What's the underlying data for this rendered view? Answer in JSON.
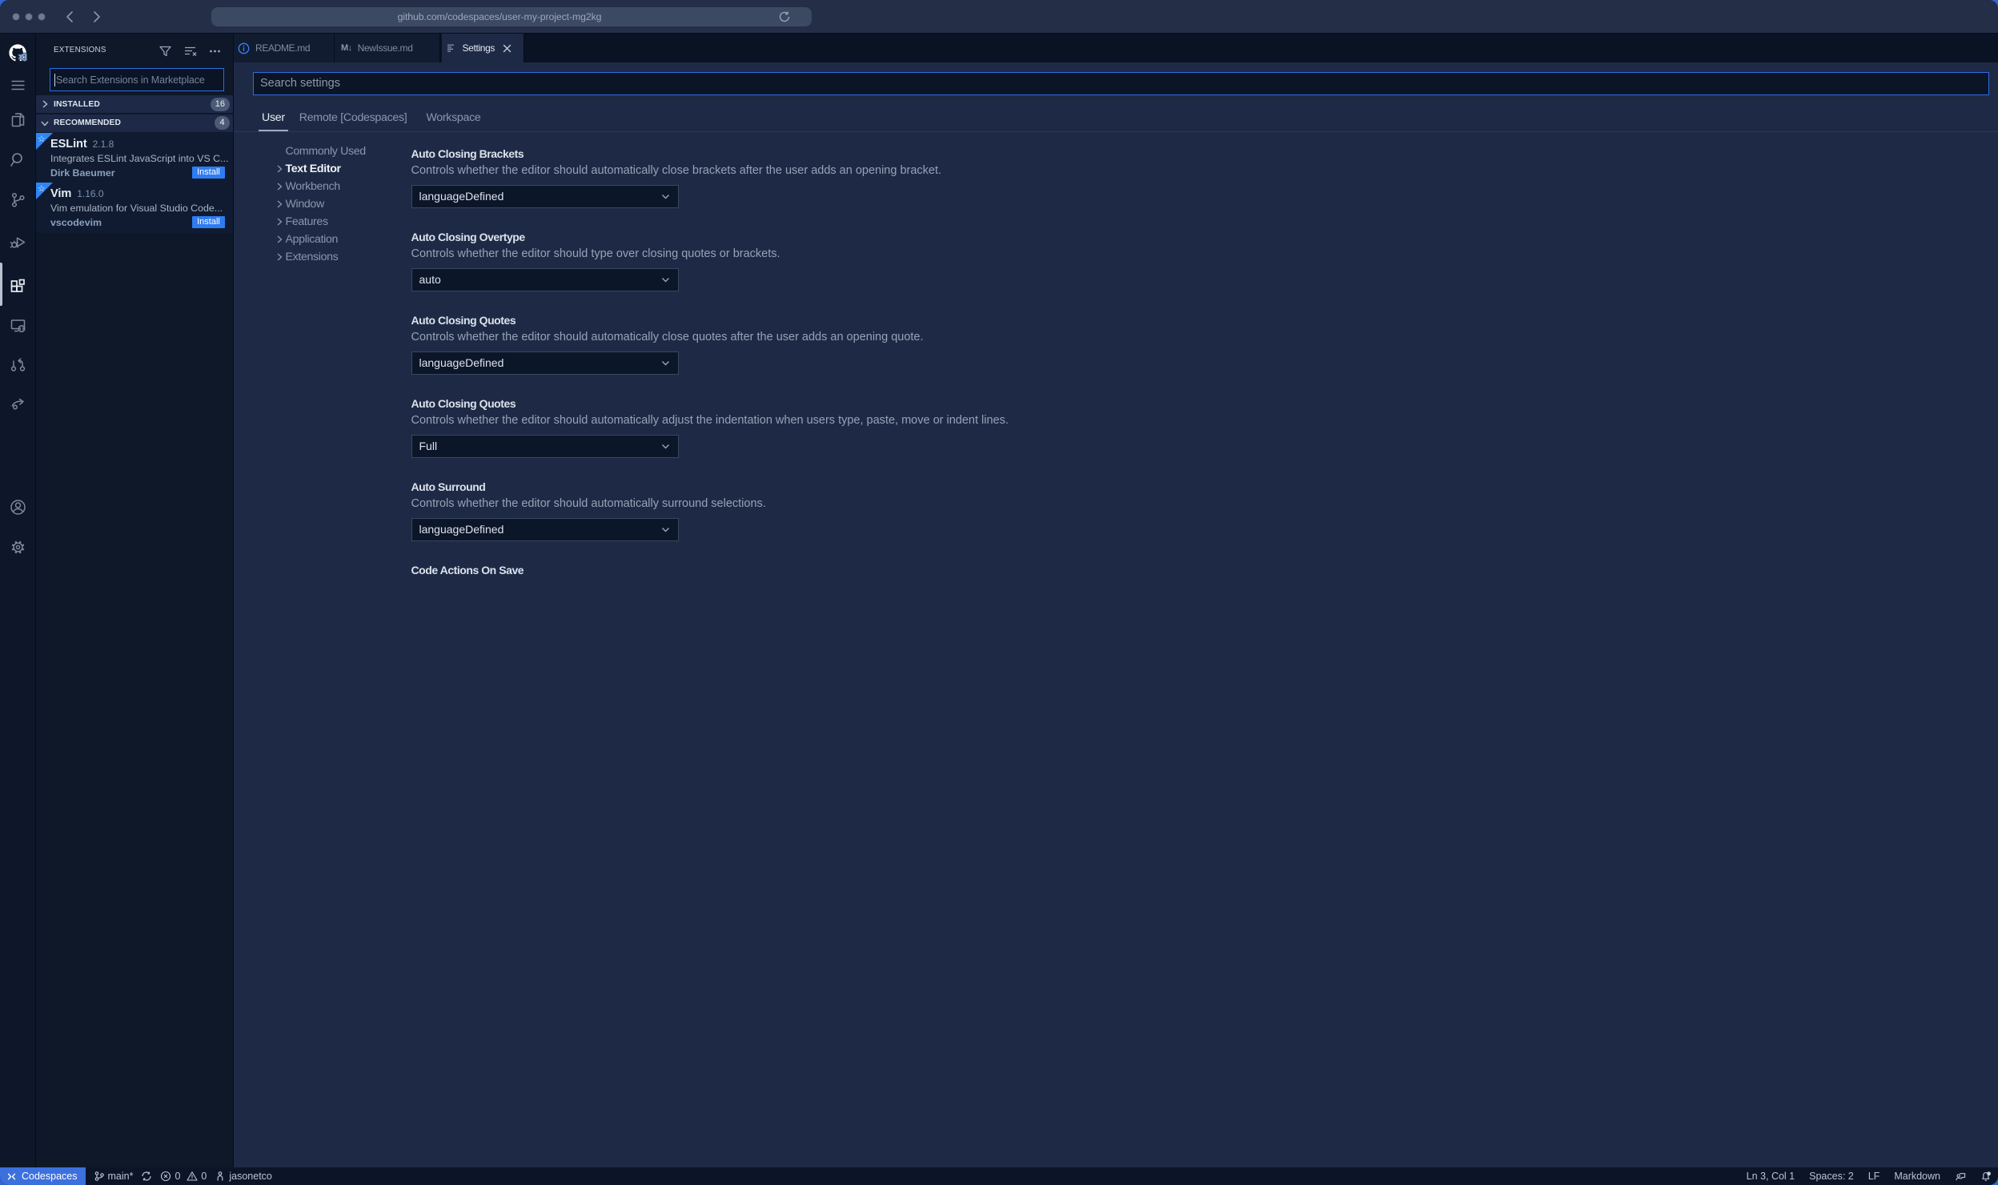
{
  "browser": {
    "url": "github.com/codespaces/user-my-project-mg2kg"
  },
  "activity_bar": {
    "items": [
      "github-logo",
      "menu",
      "explorer",
      "search",
      "source-control",
      "run-debug",
      "extensions",
      "remote-explorer",
      "pull-requests",
      "live-share",
      "account",
      "settings-gear"
    ],
    "active_item": "extensions"
  },
  "sidebar": {
    "title": "EXTENSIONS",
    "search": {
      "placeholder": "Search Extensions in Marketplace"
    },
    "sections": [
      {
        "label": "INSTALLED",
        "count": "16"
      },
      {
        "label": "RECOMMENDED",
        "count": "4"
      }
    ],
    "extensions": [
      {
        "name": "ESLint",
        "version": "2.1.8",
        "description": "Integrates ESLint JavaScript into VS C...",
        "publisher": "Dirk Baeumer",
        "action": "Install"
      },
      {
        "name": "Vim",
        "version": "1.16.0",
        "description": "Vim emulation for Visual Studio Code...",
        "publisher": "vscodevim",
        "action": "Install"
      }
    ]
  },
  "tabs": [
    {
      "label": "README.md",
      "icon": "info"
    },
    {
      "label": "NewIssue.md",
      "icon": "markdown"
    },
    {
      "label": "Settings",
      "icon": "settings-editor",
      "active": true
    }
  ],
  "settings_editor": {
    "search": {
      "placeholder": "Search settings"
    },
    "scopes": [
      {
        "label": "User",
        "active": true
      },
      {
        "label": "Remote [Codespaces]"
      },
      {
        "label": "Workspace"
      }
    ],
    "toc": [
      {
        "label": "Commonly Used"
      },
      {
        "label": "Text Editor",
        "active": true,
        "chevron": true
      },
      {
        "label": "Workbench",
        "chevron": true
      },
      {
        "label": "Window",
        "chevron": true
      },
      {
        "label": "Features",
        "chevron": true
      },
      {
        "label": "Application",
        "chevron": true
      },
      {
        "label": "Extensions",
        "chevron": true
      }
    ],
    "rows": [
      {
        "title": "Auto Closing Brackets",
        "description": "Controls whether the editor should automatically close brackets after the user adds an opening bracket.",
        "value": "languageDefined"
      },
      {
        "title": "Auto Closing Overtype",
        "description": "Controls whether the editor should type over closing quotes or brackets.",
        "value": "auto"
      },
      {
        "title": "Auto Closing Quotes",
        "description": "Controls whether the editor should automatically close quotes after the user adds an opening quote.",
        "value": "languageDefined"
      },
      {
        "title": "Auto Closing Quotes",
        "description": "Controls whether the editor should automatically adjust the indentation when users type, paste, move or indent lines.",
        "value": "Full"
      },
      {
        "title": "Auto Surround",
        "description": "Controls whether the editor should automatically surround selections.",
        "value": "languageDefined"
      },
      {
        "title": "Code Actions On Save",
        "description": "",
        "value": ""
      }
    ]
  },
  "status_bar": {
    "remote": "Codespaces",
    "branch": "main*",
    "errors": "0",
    "warnings": "0",
    "user": "jasonetco",
    "line_col": "Ln 3, Col 1",
    "indentation": "Spaces: 2",
    "eol": "LF",
    "language": "Markdown"
  },
  "colors": {
    "desktop_background": "#3365d3",
    "titlebar": "#242e47",
    "focus_border": "#2d6be2",
    "install_button": "#2e7cf2",
    "ribbon": "#2e86f5",
    "remote_status": "#3b70dd",
    "editor_background": "#1e2a45",
    "shell_background": "#0d1628"
  }
}
